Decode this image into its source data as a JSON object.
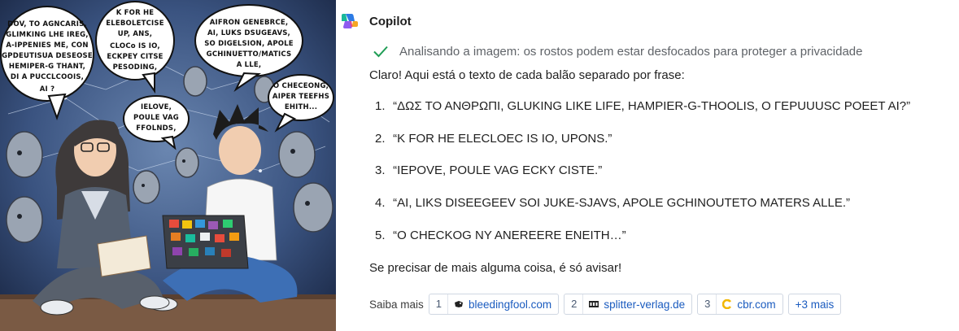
{
  "app": {
    "name": "Copilot"
  },
  "status": {
    "text": "Analisando a imagem: os rostos podem estar desfocados para proteger a privacidade"
  },
  "message": {
    "intro": "Claro! Aqui está o texto de cada balão separado por frase:",
    "items": [
      {
        "num": "1.",
        "text": "“ΔΩΣ ΤΟ ΑΝΘΡΩΠΙ, GLUKING LIKE LIFE, HAMPIER-G-THOOLIS, Ο ΓΕΡUUUSC POEET AI?”"
      },
      {
        "num": "2.",
        "text": "“K FOR HE ELECLOEC IS IO, UPONS.”"
      },
      {
        "num": "3.",
        "text": "“IEPOVE, POULE VAG ECKY CISTE.”"
      },
      {
        "num": "4.",
        "text": "“AI, LIKS DISEEGEEV SOI JUKE-SJAVS, APOLE GCHINOUTETO MATERS ALLE.”"
      },
      {
        "num": "5.",
        "text": "“O CHECKOG NY ANEREERE ENEITH…”"
      }
    ],
    "outro": "Se precisar de mais alguma coisa, é só avisar!"
  },
  "sources": {
    "label": "Saiba mais",
    "chips": [
      {
        "index": "1",
        "domain": "bleedingfool.com",
        "icon": "bleedingfool-favicon"
      },
      {
        "index": "2",
        "domain": "splitter-verlag.de",
        "icon": "splitter-favicon"
      },
      {
        "index": "3",
        "domain": "cbr.com",
        "icon": "cbr-favicon"
      }
    ],
    "more": "+3 mais"
  },
  "comic": {
    "bubbles": {
      "b1": [
        "DOV, TO AGNCARIS,",
        "GLIMKING LHE IREG,",
        "A-IPPENIES ME, CON",
        "GPDEUTISUA DESEOSE",
        "HEMIPER-G THANT,",
        "DI A PUCCLCOOIS,",
        "AI ?"
      ],
      "b2": [
        "K FOR HE",
        "ELEBOLETCISE",
        "UP, ANS,",
        "CLOCo IS IO,",
        "ECKPEY CITSE",
        "PESODING,"
      ],
      "b3": [
        "AIFRON GENEBRCE,",
        "AI, LUKS DSUGEAVS,",
        "SO DIGELSION, APOLE",
        "GCHINUETTO/MATICS",
        "A LLE,"
      ],
      "b4": [
        "IELOVE,",
        "POULE VAG",
        "FFOLNDS,"
      ],
      "b5": [
        "O CHECEONG,",
        "AIPER TEEFHS",
        "EHITH..."
      ]
    }
  },
  "colors": {
    "accent_link": "#1a5bbf",
    "check": "#1f9d55",
    "status_gray": "#5f6368",
    "comic_bg": "#2e4266"
  }
}
